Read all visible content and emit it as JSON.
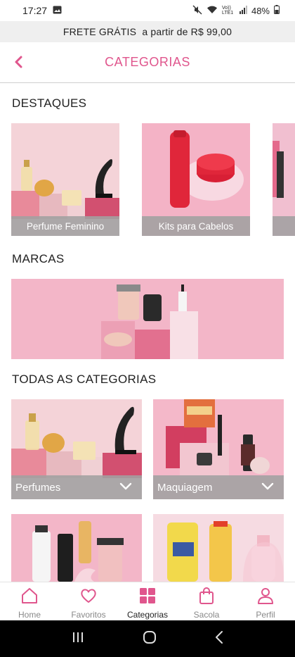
{
  "status_bar": {
    "time": "17:27",
    "battery": "48%",
    "network": "Vo)) LTE1"
  },
  "promo": {
    "text": "FRETE GRÁTIS  a partir de R$ 99,00"
  },
  "header": {
    "title": "CATEGORIAS"
  },
  "sections": {
    "destaques": "DESTAQUES",
    "marcas": "MARCAS",
    "todas": "TODAS AS CATEGORIAS"
  },
  "destaques": [
    {
      "label": "Perfume Feminino"
    },
    {
      "label": "Kits para Cabelos"
    }
  ],
  "categories": [
    {
      "label": "Perfumes"
    },
    {
      "label": "Maquiagem"
    }
  ],
  "bottom_nav": [
    {
      "label": "Home",
      "icon": "home-icon"
    },
    {
      "label": "Favoritos",
      "icon": "heart-icon"
    },
    {
      "label": "Categorias",
      "icon": "grid-icon"
    },
    {
      "label": "Sacola",
      "icon": "bag-icon"
    },
    {
      "label": "Perfil",
      "icon": "user-icon"
    }
  ],
  "colors": {
    "accent": "#e0568d",
    "product_bg": "#f4b3c6",
    "caption_bg": "#a0a0a0"
  }
}
